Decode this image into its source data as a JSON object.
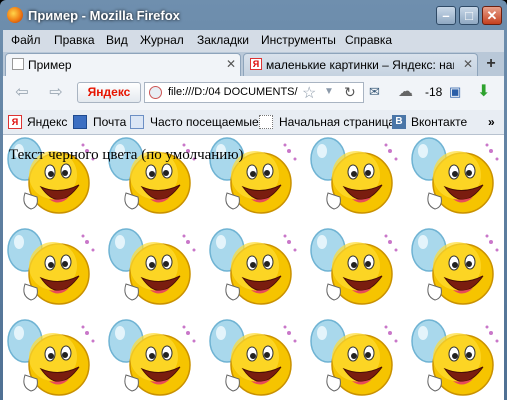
{
  "window": {
    "title": "Пример - Mozilla Firefox"
  },
  "menu": [
    "Файл",
    "Правка",
    "Вид",
    "Журнал",
    "Закладки",
    "Инструменты",
    "Справка"
  ],
  "tabs": [
    {
      "label": "Пример",
      "active": true
    },
    {
      "label": "маленькие картинки – Яндекс: наш...",
      "active": false
    }
  ],
  "navbar": {
    "yandex_label": "Яндекс",
    "url": "file:///D:/04 DOCUMENTS/",
    "weather": "-18"
  },
  "bookmarks": [
    "Яндекс",
    "Почта",
    "Часто посещаемые",
    "Начальная страница",
    "Вконтакте"
  ],
  "content": {
    "text": "Текст черного цвета (по умолчанию)"
  }
}
